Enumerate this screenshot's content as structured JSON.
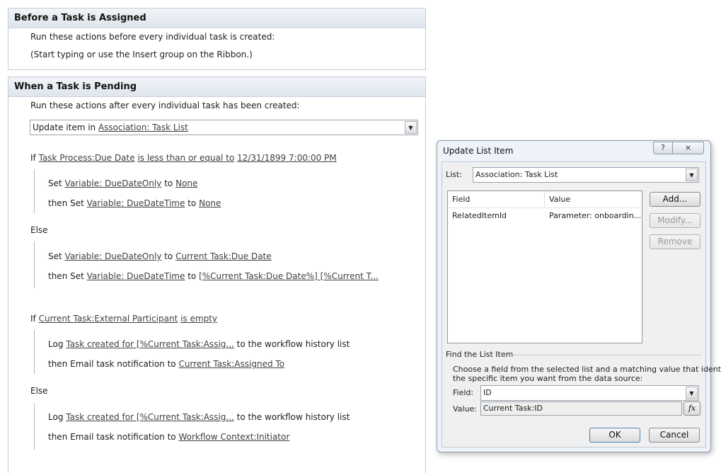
{
  "before_panel": {
    "title": "Before a Task is Assigned",
    "line1": "Run these actions before every individual task is created:",
    "line2": "(Start typing or use the Insert group on the Ribbon.)"
  },
  "pending_panel": {
    "title": "When a Task is Pending",
    "intro": "Run these actions after every individual task has been created:",
    "update_action": {
      "prefix": "Update item in",
      "list_link": "Association: Task List"
    },
    "cond1": {
      "if": "If",
      "field": "Task Process:Due Date",
      "op": "is less than or equal to",
      "value": "12/31/1899 7:00:00 PM",
      "then_a": {
        "set": "Set",
        "var": "Variable: DueDateOnly",
        "to": "to",
        "val": "None"
      },
      "then_b": {
        "set": "then Set",
        "var": "Variable: DueDateTime",
        "to": "to",
        "val": "None"
      },
      "else": "Else",
      "else_a": {
        "set": "Set",
        "var": "Variable: DueDateOnly",
        "to": "to",
        "val": "Current Task:Due Date"
      },
      "else_b": {
        "set": "then Set",
        "var": "Variable: DueDateTime",
        "to": "to",
        "val": "[%Current Task:Due Date%] [%Current T..."
      }
    },
    "cond2": {
      "if": "If",
      "field": "Current Task:External Participant",
      "op": "is empty",
      "then_a": {
        "log": "Log",
        "msg": "Task created for [%Current Task:Assig...",
        "tail": "to the workflow history list"
      },
      "then_b": {
        "email": "then Email task notification to",
        "to": "Current Task:Assigned To"
      },
      "else": "Else",
      "else_a": {
        "log": "Log",
        "msg": "Task created for [%Current Task:Assig...",
        "tail": "to the workflow history list"
      },
      "else_b": {
        "email": "then Email task notification to",
        "to": "Workflow Context:Initiator"
      }
    }
  },
  "dialog": {
    "title": "Update List Item",
    "help_label": "?",
    "close_label": "⨯",
    "list_label": "List:",
    "list_value": "Association: Task List",
    "columns": [
      "Field",
      "Value"
    ],
    "rows": [
      {
        "field": "RelatedItemId",
        "value": "Parameter: onboardin..."
      }
    ],
    "add_label": "Add...",
    "modify_label": "Modify...",
    "remove_label": "Remove",
    "find_title": "Find the List Item",
    "find_desc1": "Choose a field from the selected list and a matching value that identifies",
    "find_desc2": "the specific item you want from the data source:",
    "field_label": "Field:",
    "field_value": "ID",
    "value_label": "Value:",
    "value_value": "Current Task:ID",
    "fx_label": "fx",
    "ok_label": "OK",
    "cancel_label": "Cancel"
  }
}
